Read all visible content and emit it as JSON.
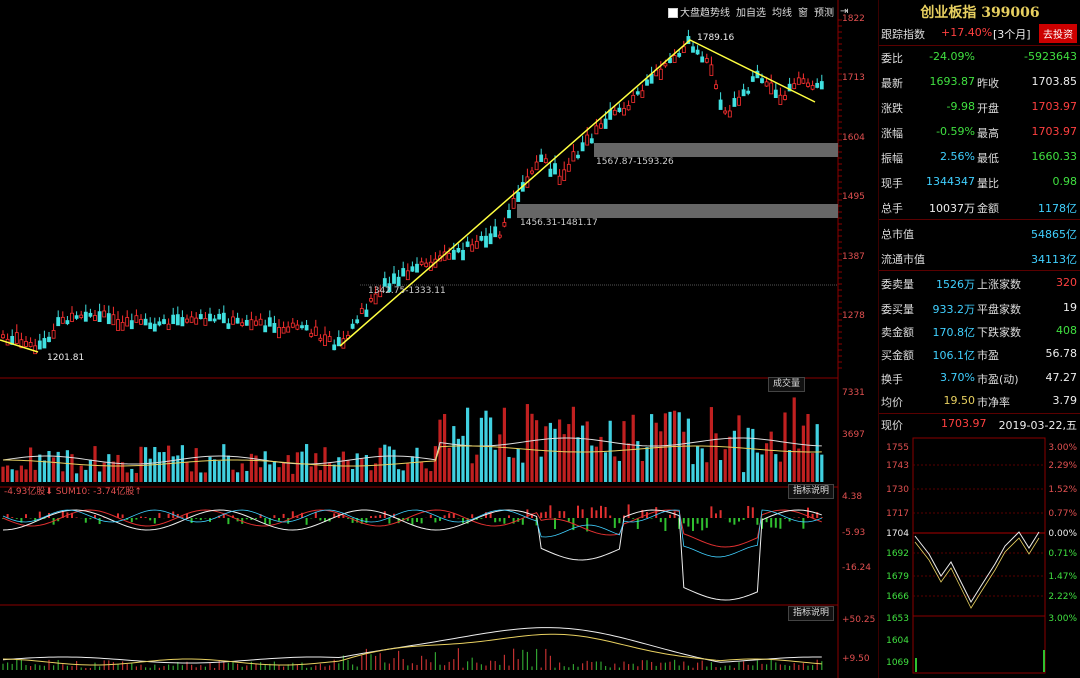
{
  "toolbar": {
    "trend_label": "大盘趋势线",
    "add_fav": "加自选",
    "ma_line": "均线",
    "window": "窗",
    "expect": "预测",
    "arrow": "⇥"
  },
  "price_axis": [
    "1822",
    "1713",
    "1604",
    "1495",
    "1387",
    "1278"
  ],
  "volume_axis": [
    "7331",
    "3697"
  ],
  "macd_axis": [
    "4.38",
    "-5.93",
    "-16.24"
  ],
  "kdj_axis": [
    "+50.25",
    "+9.50"
  ],
  "annotations": {
    "peak": "1789.16",
    "low": "1201.81",
    "gap1": "1567.87-1593.26",
    "gap2": "1456.31-1481.17",
    "gap3": "1342.75-1333.11"
  },
  "panels": {
    "volume_label": "成交量",
    "money_flow": "-4.93亿股⬇  SUM10: -3.74亿股↑",
    "indicator_desc": "指标说明",
    "indicator_desc2": "指标说明"
  },
  "quote": {
    "title": "创业板指 399006",
    "track_label": "跟踪指数",
    "track_value": "+17.40%",
    "track_period": "[3个月]",
    "invest_button": "去投资",
    "rows": [
      {
        "l": "委比",
        "v1": "-24.09%",
        "c1": "green",
        "l2": "",
        "v2": "-5923643",
        "c2": "green"
      },
      {
        "l": "最新",
        "v1": "1693.87",
        "c1": "green",
        "l2": "昨收",
        "v2": "1703.85",
        "c2": "white"
      },
      {
        "l": "涨跌",
        "v1": "-9.98",
        "c1": "green",
        "l2": "开盘",
        "v2": "1703.97",
        "c2": "red"
      },
      {
        "l": "涨幅",
        "v1": "-0.59%",
        "c1": "green",
        "l2": "最高",
        "v2": "1703.97",
        "c2": "red"
      },
      {
        "l": "振幅",
        "v1": "2.56%",
        "c1": "cyan",
        "l2": "最低",
        "v2": "1660.33",
        "c2": "green"
      },
      {
        "l": "现手",
        "v1": "1344347",
        "c1": "cyan",
        "l2": "量比",
        "v2": "0.98",
        "c2": "green"
      },
      {
        "l": "总手",
        "v1": "10037万",
        "c1": "white",
        "l2": "金额",
        "v2": "1178亿",
        "c2": "cyan"
      },
      {
        "l": "总市值",
        "v1": "",
        "c1": "white",
        "l2": "",
        "v2": "54865亿",
        "c2": "cyan"
      },
      {
        "l": "流通市值",
        "v1": "",
        "c1": "white",
        "l2": "",
        "v2": "34113亿",
        "c2": "cyan"
      },
      {
        "l": "委卖量",
        "v1": "1526万",
        "c1": "cyan",
        "l2": "上涨家数",
        "v2": "320",
        "c2": "red"
      },
      {
        "l": "委买量",
        "v1": "933.2万",
        "c1": "cyan",
        "l2": "平盘家数",
        "v2": "19",
        "c2": "white"
      },
      {
        "l": "卖金额",
        "v1": "170.8亿",
        "c1": "cyan",
        "l2": "下跌家数",
        "v2": "408",
        "c2": "green"
      },
      {
        "l": "买金额",
        "v1": "106.1亿",
        "c1": "cyan",
        "l2": "市盈",
        "v2": "56.78",
        "c2": "white"
      },
      {
        "l": "换手",
        "v1": "3.70%",
        "c1": "cyan",
        "l2": "市盈(动)",
        "v2": "47.27",
        "c2": "white"
      },
      {
        "l": "均价",
        "v1": "19.50",
        "c1": "yellow",
        "l2": "市净率",
        "v2": "3.79",
        "c2": "white"
      }
    ],
    "now_label": "现价",
    "now_value": "1703.97",
    "date": "2019-03-22,五",
    "mini_left": [
      "1755",
      "1743",
      "1730",
      "1717",
      "1704",
      "1692",
      "1679",
      "1666",
      "1653",
      "1604",
      "1069"
    ],
    "mini_right": [
      "3.00%",
      "2.29%",
      "1.52%",
      "0.77%",
      "0.00%",
      "0.71%",
      "1.47%",
      "2.22%",
      "3.00%"
    ]
  }
}
